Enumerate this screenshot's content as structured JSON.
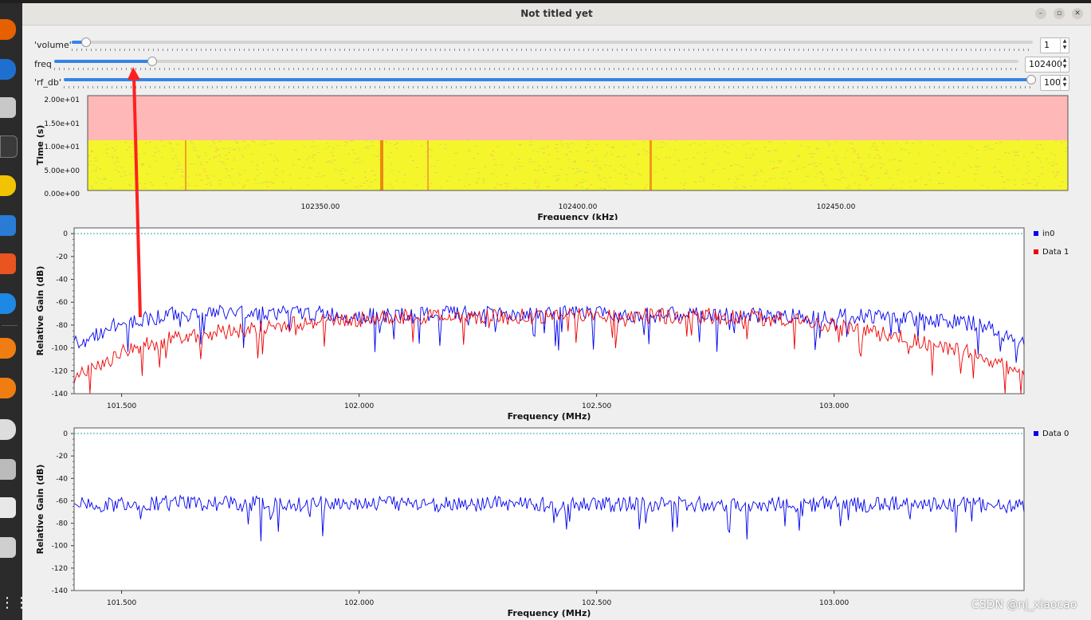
{
  "window": {
    "title": "Not titled yet",
    "minimize": "–",
    "maximize": "▫",
    "close": "✕"
  },
  "controls": {
    "volume": {
      "label": "'volume'",
      "value": "1",
      "level": 0.01
    },
    "freq": {
      "label": "freq",
      "value": "102400",
      "level": 0.1
    },
    "rf_db": {
      "label": "'rf_db'",
      "value": "100",
      "level": 1.0
    }
  },
  "waterfall": {
    "ylabel": "Time (s)",
    "xlabel": "Frequency (kHz)",
    "yticks": [
      "2.00e+01",
      "1.50e+01",
      "1.00e+01",
      "5.00e+00",
      "0.00e+00"
    ],
    "xticks": [
      "102350.00",
      "102400.00",
      "102450.00"
    ],
    "colors": {
      "empty": "#ffb8b8",
      "floor": "#f5f52c",
      "peak": "#e98b12"
    }
  },
  "chart_data": [
    {
      "type": "line",
      "xlabel": "Frequency (MHz)",
      "ylabel": "Relative Gain (dB)",
      "xlim": [
        101.4,
        103.4
      ],
      "ylim": [
        -140,
        5
      ],
      "xticks": [
        "101.500",
        "102.000",
        "102.500",
        "103.000"
      ],
      "yticks": [
        "0",
        "-20",
        "-40",
        "-60",
        "-80",
        "-100",
        "-120",
        "-140"
      ],
      "series": [
        {
          "name": "in0",
          "color": "#0000ee",
          "x": [
            101.4,
            101.5,
            101.6,
            101.7,
            101.8,
            101.9,
            102.0,
            102.1,
            102.2,
            102.3,
            102.4,
            102.5,
            102.6,
            102.7,
            102.8,
            102.9,
            103.0,
            103.1,
            103.2,
            103.3,
            103.4
          ],
          "values": [
            -97,
            -78,
            -71,
            -69,
            -69,
            -70,
            -72,
            -72,
            -70,
            -71,
            -70,
            -70,
            -71,
            -71,
            -72,
            -72,
            -72,
            -72,
            -75,
            -79,
            -95
          ]
        },
        {
          "name": "Data 1",
          "color": "#ee0000",
          "x": [
            101.4,
            101.5,
            101.6,
            101.7,
            101.8,
            101.9,
            102.0,
            102.1,
            102.2,
            102.3,
            102.4,
            102.5,
            102.6,
            102.7,
            102.8,
            102.9,
            103.0,
            103.1,
            103.2,
            103.3,
            103.4
          ],
          "values": [
            -127,
            -104,
            -92,
            -86,
            -83,
            -77,
            -75,
            -73,
            -72,
            -73,
            -72,
            -71,
            -72,
            -72,
            -73,
            -75,
            -80,
            -88,
            -96,
            -106,
            -123
          ]
        }
      ],
      "reference_line": 0
    },
    {
      "type": "line",
      "xlabel": "Frequency (MHz)",
      "ylabel": "Relative Gain (dB)",
      "xlim": [
        101.4,
        103.4
      ],
      "ylim": [
        -140,
        5
      ],
      "xticks": [
        "101.500",
        "102.000",
        "102.500",
        "103.000"
      ],
      "yticks": [
        "0",
        "-20",
        "-40",
        "-60",
        "-80",
        "-100",
        "-120",
        "-140"
      ],
      "series": [
        {
          "name": "Data 0",
          "color": "#0000ee",
          "x": [
            101.4,
            101.6,
            101.8,
            102.0,
            102.2,
            102.4,
            102.6,
            102.8,
            103.0,
            103.2,
            103.4
          ],
          "values": [
            -64,
            -62,
            -63,
            -62,
            -63,
            -63,
            -63,
            -63,
            -63,
            -63,
            -64
          ]
        }
      ],
      "reference_line": 0
    }
  ],
  "watermark": "CSDN @nj_xiaocao"
}
